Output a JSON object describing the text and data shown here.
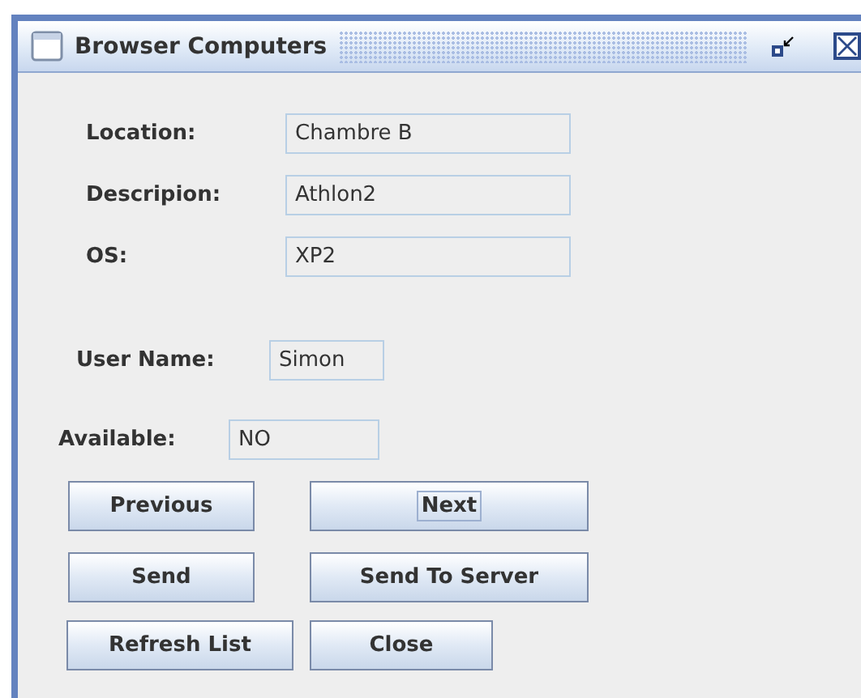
{
  "window": {
    "title": "Browser Computers"
  },
  "fields": [
    {
      "label": "Location:",
      "value": "Chambre B"
    },
    {
      "label": "Descripion:",
      "value": "Athlon2"
    },
    {
      "label": "OS:",
      "value": "XP2"
    },
    {
      "label": "User Name:",
      "value": "Simon"
    },
    {
      "label": "Available:",
      "value": "NO"
    }
  ],
  "buttons": [
    {
      "label": "Previous",
      "focused": false
    },
    {
      "label": "Next",
      "focused": true
    },
    {
      "label": "Send",
      "focused": false
    },
    {
      "label": "Send To Server",
      "focused": false
    },
    {
      "label": "Refresh List",
      "focused": false
    },
    {
      "label": "Close",
      "focused": false
    }
  ]
}
